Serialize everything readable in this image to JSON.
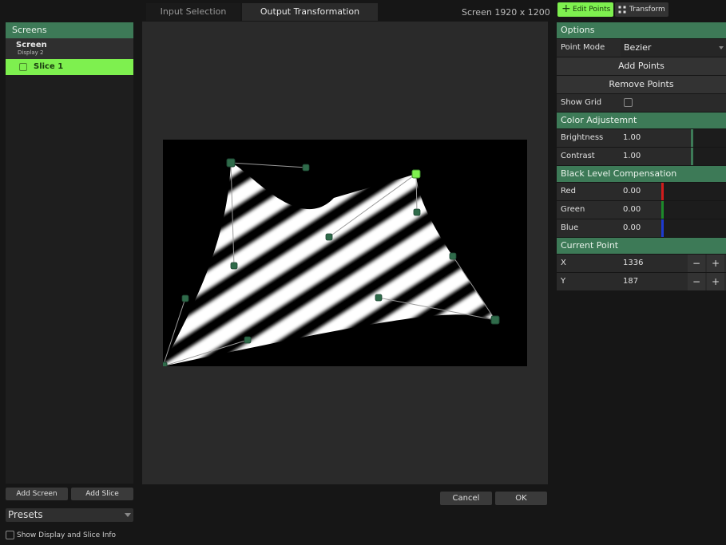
{
  "screens_panel": {
    "header": "Screens",
    "screen": {
      "name": "Screen",
      "display": "Display 2"
    },
    "slice": {
      "label": "Slice 1"
    }
  },
  "left_buttons": {
    "add_screen": "Add Screen",
    "add_slice": "Add Slice"
  },
  "presets": {
    "label": "Presets"
  },
  "show_info": {
    "label": "Show Display and Slice Info"
  },
  "tabs": [
    {
      "label": "Input Selection",
      "active": false
    },
    {
      "label": "Output Transformation",
      "active": true
    }
  ],
  "screen_info": "Screen  1920 x 1200",
  "top_right": {
    "edit_points": "Edit Points",
    "transform": "Transform"
  },
  "options": {
    "header": "Options",
    "point_mode_label": "Point Mode",
    "point_mode_value": "Bezier",
    "add_points": "Add Points",
    "remove_points": "Remove Points",
    "show_grid_label": "Show Grid"
  },
  "color_adjustment": {
    "header": "Color Adjustemnt",
    "brightness_label": "Brightness",
    "brightness_value": "1.00",
    "contrast_label": "Contrast",
    "contrast_value": "1.00"
  },
  "black_level": {
    "header": "Black Level Compensation",
    "red_label": "Red",
    "red_value": "0.00",
    "green_label": "Green",
    "green_value": "0.00",
    "blue_label": "Blue",
    "blue_value": "0.00"
  },
  "current_point": {
    "header": "Current Point",
    "x_label": "X",
    "x_value": "1336",
    "y_label": "Y",
    "y_value": "187",
    "minus": "−",
    "plus": "+"
  },
  "dialog": {
    "cancel": "Cancel",
    "ok": "OK"
  },
  "colors": {
    "accent_green": "#3d7a57",
    "slice_highlight": "#7ef04f",
    "handle": "#2f6b4a",
    "red_bar": "#d01c1c",
    "green_bar": "#1d8a2b",
    "blue_bar": "#1d3ad0"
  }
}
